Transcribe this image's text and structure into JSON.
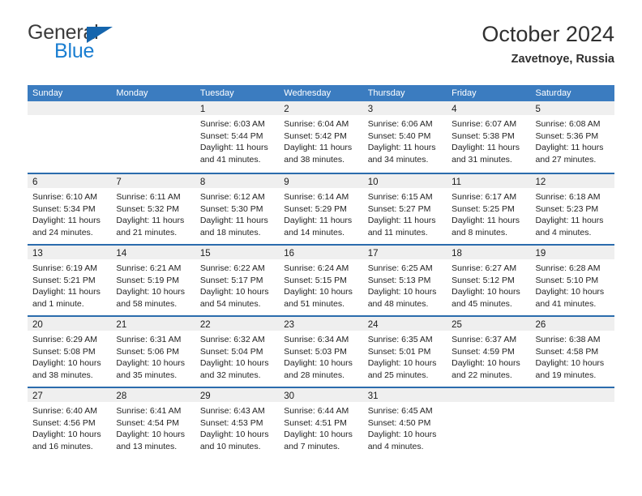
{
  "brand": {
    "name_top": "General",
    "name_bottom": "Blue",
    "triangle_color": "#1565ad",
    "blue_color": "#1a7ed1"
  },
  "header": {
    "title": "October 2024",
    "subtitle": "Zavetnoye, Russia"
  },
  "theme": {
    "header_bar": "#3b7cc0",
    "week_rule": "#2b6cad",
    "day_strip": "#efefef"
  },
  "weekday_headers": [
    "Sunday",
    "Monday",
    "Tuesday",
    "Wednesday",
    "Thursday",
    "Friday",
    "Saturday"
  ],
  "weeks": [
    [
      {
        "day": "",
        "empty": true,
        "sunrise": "",
        "sunset": "",
        "daylight1": "",
        "daylight2": ""
      },
      {
        "day": "",
        "empty": true,
        "sunrise": "",
        "sunset": "",
        "daylight1": "",
        "daylight2": ""
      },
      {
        "day": "1",
        "sunrise": "Sunrise: 6:03 AM",
        "sunset": "Sunset: 5:44 PM",
        "daylight1": "Daylight: 11 hours",
        "daylight2": "and 41 minutes."
      },
      {
        "day": "2",
        "sunrise": "Sunrise: 6:04 AM",
        "sunset": "Sunset: 5:42 PM",
        "daylight1": "Daylight: 11 hours",
        "daylight2": "and 38 minutes."
      },
      {
        "day": "3",
        "sunrise": "Sunrise: 6:06 AM",
        "sunset": "Sunset: 5:40 PM",
        "daylight1": "Daylight: 11 hours",
        "daylight2": "and 34 minutes."
      },
      {
        "day": "4",
        "sunrise": "Sunrise: 6:07 AM",
        "sunset": "Sunset: 5:38 PM",
        "daylight1": "Daylight: 11 hours",
        "daylight2": "and 31 minutes."
      },
      {
        "day": "5",
        "sunrise": "Sunrise: 6:08 AM",
        "sunset": "Sunset: 5:36 PM",
        "daylight1": "Daylight: 11 hours",
        "daylight2": "and 27 minutes."
      }
    ],
    [
      {
        "day": "6",
        "sunrise": "Sunrise: 6:10 AM",
        "sunset": "Sunset: 5:34 PM",
        "daylight1": "Daylight: 11 hours",
        "daylight2": "and 24 minutes."
      },
      {
        "day": "7",
        "sunrise": "Sunrise: 6:11 AM",
        "sunset": "Sunset: 5:32 PM",
        "daylight1": "Daylight: 11 hours",
        "daylight2": "and 21 minutes."
      },
      {
        "day": "8",
        "sunrise": "Sunrise: 6:12 AM",
        "sunset": "Sunset: 5:30 PM",
        "daylight1": "Daylight: 11 hours",
        "daylight2": "and 18 minutes."
      },
      {
        "day": "9",
        "sunrise": "Sunrise: 6:14 AM",
        "sunset": "Sunset: 5:29 PM",
        "daylight1": "Daylight: 11 hours",
        "daylight2": "and 14 minutes."
      },
      {
        "day": "10",
        "sunrise": "Sunrise: 6:15 AM",
        "sunset": "Sunset: 5:27 PM",
        "daylight1": "Daylight: 11 hours",
        "daylight2": "and 11 minutes."
      },
      {
        "day": "11",
        "sunrise": "Sunrise: 6:17 AM",
        "sunset": "Sunset: 5:25 PM",
        "daylight1": "Daylight: 11 hours",
        "daylight2": "and 8 minutes."
      },
      {
        "day": "12",
        "sunrise": "Sunrise: 6:18 AM",
        "sunset": "Sunset: 5:23 PM",
        "daylight1": "Daylight: 11 hours",
        "daylight2": "and 4 minutes."
      }
    ],
    [
      {
        "day": "13",
        "sunrise": "Sunrise: 6:19 AM",
        "sunset": "Sunset: 5:21 PM",
        "daylight1": "Daylight: 11 hours",
        "daylight2": "and 1 minute."
      },
      {
        "day": "14",
        "sunrise": "Sunrise: 6:21 AM",
        "sunset": "Sunset: 5:19 PM",
        "daylight1": "Daylight: 10 hours",
        "daylight2": "and 58 minutes."
      },
      {
        "day": "15",
        "sunrise": "Sunrise: 6:22 AM",
        "sunset": "Sunset: 5:17 PM",
        "daylight1": "Daylight: 10 hours",
        "daylight2": "and 54 minutes."
      },
      {
        "day": "16",
        "sunrise": "Sunrise: 6:24 AM",
        "sunset": "Sunset: 5:15 PM",
        "daylight1": "Daylight: 10 hours",
        "daylight2": "and 51 minutes."
      },
      {
        "day": "17",
        "sunrise": "Sunrise: 6:25 AM",
        "sunset": "Sunset: 5:13 PM",
        "daylight1": "Daylight: 10 hours",
        "daylight2": "and 48 minutes."
      },
      {
        "day": "18",
        "sunrise": "Sunrise: 6:27 AM",
        "sunset": "Sunset: 5:12 PM",
        "daylight1": "Daylight: 10 hours",
        "daylight2": "and 45 minutes."
      },
      {
        "day": "19",
        "sunrise": "Sunrise: 6:28 AM",
        "sunset": "Sunset: 5:10 PM",
        "daylight1": "Daylight: 10 hours",
        "daylight2": "and 41 minutes."
      }
    ],
    [
      {
        "day": "20",
        "sunrise": "Sunrise: 6:29 AM",
        "sunset": "Sunset: 5:08 PM",
        "daylight1": "Daylight: 10 hours",
        "daylight2": "and 38 minutes."
      },
      {
        "day": "21",
        "sunrise": "Sunrise: 6:31 AM",
        "sunset": "Sunset: 5:06 PM",
        "daylight1": "Daylight: 10 hours",
        "daylight2": "and 35 minutes."
      },
      {
        "day": "22",
        "sunrise": "Sunrise: 6:32 AM",
        "sunset": "Sunset: 5:04 PM",
        "daylight1": "Daylight: 10 hours",
        "daylight2": "and 32 minutes."
      },
      {
        "day": "23",
        "sunrise": "Sunrise: 6:34 AM",
        "sunset": "Sunset: 5:03 PM",
        "daylight1": "Daylight: 10 hours",
        "daylight2": "and 28 minutes."
      },
      {
        "day": "24",
        "sunrise": "Sunrise: 6:35 AM",
        "sunset": "Sunset: 5:01 PM",
        "daylight1": "Daylight: 10 hours",
        "daylight2": "and 25 minutes."
      },
      {
        "day": "25",
        "sunrise": "Sunrise: 6:37 AM",
        "sunset": "Sunset: 4:59 PM",
        "daylight1": "Daylight: 10 hours",
        "daylight2": "and 22 minutes."
      },
      {
        "day": "26",
        "sunrise": "Sunrise: 6:38 AM",
        "sunset": "Sunset: 4:58 PM",
        "daylight1": "Daylight: 10 hours",
        "daylight2": "and 19 minutes."
      }
    ],
    [
      {
        "day": "27",
        "sunrise": "Sunrise: 6:40 AM",
        "sunset": "Sunset: 4:56 PM",
        "daylight1": "Daylight: 10 hours",
        "daylight2": "and 16 minutes."
      },
      {
        "day": "28",
        "sunrise": "Sunrise: 6:41 AM",
        "sunset": "Sunset: 4:54 PM",
        "daylight1": "Daylight: 10 hours",
        "daylight2": "and 13 minutes."
      },
      {
        "day": "29",
        "sunrise": "Sunrise: 6:43 AM",
        "sunset": "Sunset: 4:53 PM",
        "daylight1": "Daylight: 10 hours",
        "daylight2": "and 10 minutes."
      },
      {
        "day": "30",
        "sunrise": "Sunrise: 6:44 AM",
        "sunset": "Sunset: 4:51 PM",
        "daylight1": "Daylight: 10 hours",
        "daylight2": "and 7 minutes."
      },
      {
        "day": "31",
        "sunrise": "Sunrise: 6:45 AM",
        "sunset": "Sunset: 4:50 PM",
        "daylight1": "Daylight: 10 hours",
        "daylight2": "and 4 minutes."
      },
      {
        "day": "",
        "empty": true,
        "sunrise": "",
        "sunset": "",
        "daylight1": "",
        "daylight2": ""
      },
      {
        "day": "",
        "empty": true,
        "sunrise": "",
        "sunset": "",
        "daylight1": "",
        "daylight2": ""
      }
    ]
  ]
}
